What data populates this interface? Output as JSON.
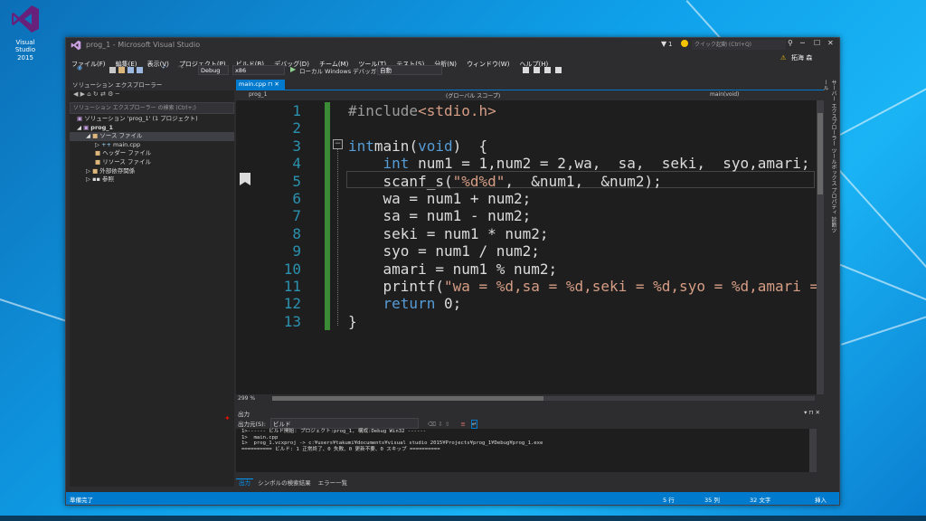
{
  "desktop": {
    "icon_label_1": "Visual Studio",
    "icon_label_2": "2015"
  },
  "window": {
    "title": "prog_1 - Microsoft Visual Studio",
    "notifications": "1",
    "quick_launch": "クイック起動 (Ctrl+Q)",
    "user": "拓海 森"
  },
  "menu": [
    "ファイル(F)",
    "編集(E)",
    "表示(V)",
    "プロジェクト(P)",
    "ビルド(B)",
    "デバッグ(D)",
    "チーム(M)",
    "ツール(T)",
    "テスト(S)",
    "分析(N)",
    "ウィンドウ(W)",
    "ヘルプ(H)"
  ],
  "toolbar": {
    "config": "Debug",
    "platform": "x86",
    "run_label": "ローカル Windows デバッガー",
    "auto": "自動"
  },
  "solution_explorer": {
    "title": "ソリューション エクスプローラー",
    "search_placeholder": "ソリューション エクスプローラー の検索 (Ctrl+;)",
    "items": [
      {
        "label": "ソリューション 'prog_1' (1 プロジェクト)",
        "indent": 0
      },
      {
        "label": "prog_1",
        "indent": 1
      },
      {
        "label": "ソース ファイル",
        "indent": 2
      },
      {
        "label": "main.cpp",
        "indent": 3
      },
      {
        "label": "ヘッダー ファイル",
        "indent": 2
      },
      {
        "label": "リソース ファイル",
        "indent": 2
      },
      {
        "label": "外部依存関係",
        "indent": 1
      },
      {
        "label": "参照",
        "indent": 1
      }
    ]
  },
  "editor": {
    "tab": "main.cpp",
    "nav_project": "prog_1",
    "nav_scope": "(グローバル スコープ)",
    "nav_func": "main(void)",
    "zoom": "299 %",
    "lines": [
      {
        "n": "1",
        "indent": "",
        "parts": [
          [
            "inc",
            "#include"
          ],
          [
            "str",
            "<stdio.h>"
          ]
        ]
      },
      {
        "n": "2",
        "indent": "",
        "parts": []
      },
      {
        "n": "3",
        "indent": "",
        "parts": [
          [
            "kw",
            "int"
          ],
          [
            "",
            "main("
          ],
          [
            "kw",
            "void"
          ],
          [
            "",
            ")  {"
          ]
        ]
      },
      {
        "n": "4",
        "indent": "    ",
        "parts": [
          [
            "kw",
            "int"
          ],
          [
            "",
            " num1 = 1,num2 = 2,wa,  sa,  seki,  syo,amari;"
          ]
        ]
      },
      {
        "n": "5",
        "indent": "    ",
        "parts": [
          [
            "",
            "scanf_s("
          ],
          [
            "str",
            "\"%d%d\""
          ],
          [
            "",
            ",  &num1,  &num2);"
          ]
        ]
      },
      {
        "n": "6",
        "indent": "    ",
        "parts": [
          [
            "",
            "wa = num1 + num2;"
          ]
        ]
      },
      {
        "n": "7",
        "indent": "    ",
        "parts": [
          [
            "",
            "sa = num1 - num2;"
          ]
        ]
      },
      {
        "n": "8",
        "indent": "    ",
        "parts": [
          [
            "",
            "seki = num1 * num2;"
          ]
        ]
      },
      {
        "n": "9",
        "indent": "    ",
        "parts": [
          [
            "",
            "syo = num1 / num2;"
          ]
        ]
      },
      {
        "n": "10",
        "indent": "    ",
        "parts": [
          [
            "",
            "amari = num1 % num2;"
          ]
        ]
      },
      {
        "n": "11",
        "indent": "    ",
        "parts": [
          [
            "",
            "printf("
          ],
          [
            "str",
            "\"wa = %d,sa = %d,seki = %d,syo = %d,amari = %d¥"
          ]
        ]
      },
      {
        "n": "12",
        "indent": "    ",
        "parts": [
          [
            "kw",
            "return"
          ],
          [
            "",
            " 0;"
          ]
        ]
      },
      {
        "n": "13",
        "indent": "",
        "parts": [
          [
            "",
            "}"
          ]
        ]
      }
    ]
  },
  "output": {
    "title": "出力",
    "source_label": "出力元(S):",
    "source_value": "ビルド",
    "lines": [
      "1>------ ビルド開始: プロジェクト:prog_1, 構成:Debug Win32 ------",
      "1>  main.cpp",
      "1>  prog_1.vcxproj -> c:¥users¥takumi¥documents¥visual studio 2015¥Projects¥prog_1¥Debug¥prog_1.exe",
      "========== ビルド: 1 正常終了、0 失敗、0 更新不要、0 スキップ =========="
    ],
    "tabs": [
      "出力",
      "シンボルの検索結果",
      "エラー一覧"
    ]
  },
  "right_panel": "サーバー エクスプローラー  ツールボックス  プロパティ  診断ツール",
  "status": {
    "ready": "準備完了",
    "row": "5 行",
    "col": "35 列",
    "ch": "32 文字",
    "mode": "挿入"
  }
}
